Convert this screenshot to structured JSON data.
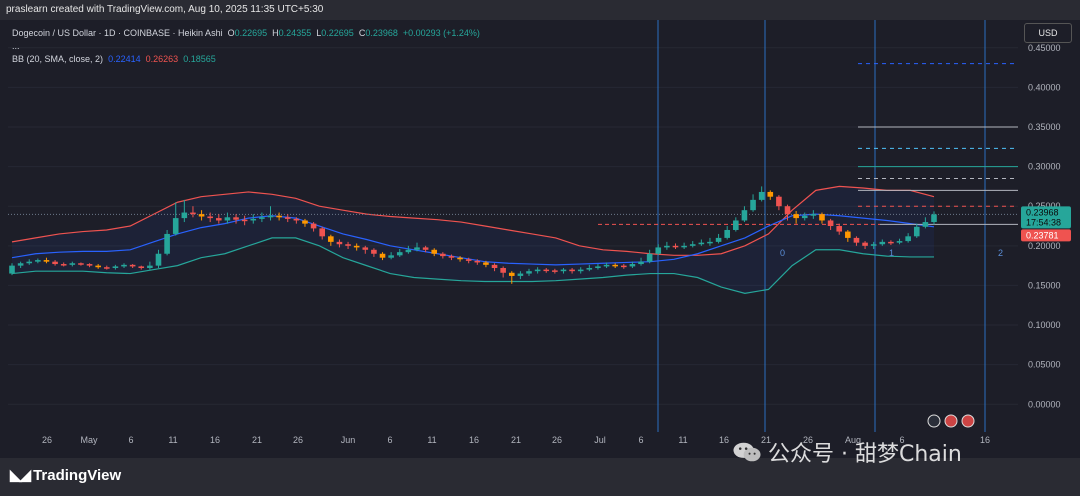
{
  "header": {
    "published": "praslearn created with TradingView.com, Aug 10, 2025 11:35 UTC+5:30"
  },
  "legend": {
    "symbol": "Dogecoin / US Dollar · 1D · COINBASE · Heikin Ashi",
    "o_label": "O",
    "o_value": "0.22695",
    "h_label": "H",
    "h_value": "0.24355",
    "l_label": "L",
    "l_value": "0.22695",
    "c_label": "C",
    "c_value": "0.23968",
    "change": "+0.00293 (+1.24%)",
    "ellipsis": "...",
    "bb_name": "BB (20, SMA, close, 2)",
    "bb_basis": "0.22414",
    "bb_upper": "0.26263",
    "bb_lower": "0.18565"
  },
  "currency_button": "USD",
  "price_tags": {
    "last_price": "0.23968",
    "countdown": "17:54:38",
    "basis_price": "0.23781"
  },
  "fib_labels": [
    "0",
    "1",
    "2"
  ],
  "footer": {
    "brand": "TradingView"
  },
  "watermark": {
    "text": "公众号 · 甜梦Chain"
  },
  "colors": {
    "up": "#26a69a",
    "down": "#ef5350",
    "orange": "#ff9800",
    "bb_upper": "#ef5350",
    "bb_basis": "#2962ff",
    "bb_lower": "#26a69a"
  },
  "chart_data": {
    "type": "candlestick",
    "y_axis_ticks": [
      "0.45000",
      "0.40000",
      "0.35000",
      "0.30000",
      "0.25000",
      "0.20000",
      "0.15000",
      "0.10000",
      "0.05000",
      "0.00000"
    ],
    "ylim": [
      -0.035,
      0.48
    ],
    "x_axis_ticks": [
      "26",
      "May",
      "6",
      "11",
      "16",
      "21",
      "26",
      "Jun",
      "6",
      "11",
      "16",
      "21",
      "26",
      "Jul",
      "6",
      "11",
      "16",
      "21",
      "26",
      "Aug",
      "6",
      "16"
    ],
    "dates_range": [
      "2025-04-21",
      "2025-08-10"
    ],
    "last_close": 0.23968,
    "horizontal_levels": [
      0.43,
      0.35,
      0.323,
      0.3,
      0.285,
      0.27,
      0.25,
      0.227
    ],
    "bb_upper": [
      0.205,
      0.21,
      0.215,
      0.218,
      0.22,
      0.225,
      0.24,
      0.255,
      0.262,
      0.265,
      0.268,
      0.265,
      0.26,
      0.25,
      0.245,
      0.24,
      0.237,
      0.235,
      0.233,
      0.23,
      0.225,
      0.22,
      0.215,
      0.21,
      0.2,
      0.195,
      0.193,
      0.19,
      0.188,
      0.188,
      0.19,
      0.2,
      0.215,
      0.245,
      0.27,
      0.275,
      0.273,
      0.27,
      0.27,
      0.262
    ],
    "bb_basis": [
      0.185,
      0.19,
      0.192,
      0.193,
      0.193,
      0.195,
      0.205,
      0.215,
      0.223,
      0.228,
      0.235,
      0.238,
      0.235,
      0.225,
      0.215,
      0.208,
      0.2,
      0.195,
      0.19,
      0.185,
      0.18,
      0.178,
      0.177,
      0.176,
      0.177,
      0.178,
      0.179,
      0.18,
      0.183,
      0.19,
      0.2,
      0.21,
      0.225,
      0.238,
      0.24,
      0.238,
      0.235,
      0.232,
      0.228,
      0.224
    ],
    "bb_lower": [
      0.165,
      0.168,
      0.168,
      0.168,
      0.166,
      0.165,
      0.17,
      0.175,
      0.185,
      0.19,
      0.2,
      0.21,
      0.21,
      0.2,
      0.185,
      0.175,
      0.165,
      0.16,
      0.158,
      0.156,
      0.155,
      0.155,
      0.155,
      0.156,
      0.158,
      0.16,
      0.163,
      0.165,
      0.165,
      0.16,
      0.148,
      0.14,
      0.145,
      0.175,
      0.195,
      0.195,
      0.19,
      0.187,
      0.186,
      0.186
    ],
    "candles": [
      {
        "o": 0.165,
        "c": 0.175,
        "h": 0.178,
        "l": 0.163
      },
      {
        "o": 0.175,
        "c": 0.178,
        "h": 0.18,
        "l": 0.172
      },
      {
        "o": 0.178,
        "c": 0.18,
        "h": 0.183,
        "l": 0.176
      },
      {
        "o": 0.18,
        "c": 0.182,
        "h": 0.184,
        "l": 0.178
      },
      {
        "o": 0.182,
        "c": 0.18,
        "h": 0.185,
        "l": 0.178
      },
      {
        "o": 0.18,
        "c": 0.177,
        "h": 0.182,
        "l": 0.175
      },
      {
        "o": 0.177,
        "c": 0.176,
        "h": 0.179,
        "l": 0.174
      },
      {
        "o": 0.176,
        "c": 0.178,
        "h": 0.18,
        "l": 0.174
      },
      {
        "o": 0.178,
        "c": 0.177,
        "h": 0.179,
        "l": 0.175
      },
      {
        "o": 0.177,
        "c": 0.175,
        "h": 0.178,
        "l": 0.173
      },
      {
        "o": 0.175,
        "c": 0.173,
        "h": 0.177,
        "l": 0.171
      },
      {
        "o": 0.173,
        "c": 0.172,
        "h": 0.175,
        "l": 0.17
      },
      {
        "o": 0.172,
        "c": 0.174,
        "h": 0.176,
        "l": 0.17
      },
      {
        "o": 0.174,
        "c": 0.176,
        "h": 0.178,
        "l": 0.172
      },
      {
        "o": 0.176,
        "c": 0.174,
        "h": 0.177,
        "l": 0.172
      },
      {
        "o": 0.174,
        "c": 0.172,
        "h": 0.175,
        "l": 0.17
      },
      {
        "o": 0.172,
        "c": 0.175,
        "h": 0.18,
        "l": 0.17
      },
      {
        "o": 0.175,
        "c": 0.19,
        "h": 0.195,
        "l": 0.172
      },
      {
        "o": 0.19,
        "c": 0.215,
        "h": 0.22,
        "l": 0.188
      },
      {
        "o": 0.215,
        "c": 0.235,
        "h": 0.255,
        "l": 0.213
      },
      {
        "o": 0.235,
        "c": 0.242,
        "h": 0.258,
        "l": 0.23
      },
      {
        "o": 0.242,
        "c": 0.24,
        "h": 0.25,
        "l": 0.236
      },
      {
        "o": 0.24,
        "c": 0.237,
        "h": 0.245,
        "l": 0.232
      },
      {
        "o": 0.237,
        "c": 0.235,
        "h": 0.242,
        "l": 0.23
      },
      {
        "o": 0.235,
        "c": 0.232,
        "h": 0.24,
        "l": 0.228
      },
      {
        "o": 0.232,
        "c": 0.236,
        "h": 0.242,
        "l": 0.228
      },
      {
        "o": 0.236,
        "c": 0.233,
        "h": 0.24,
        "l": 0.228
      },
      {
        "o": 0.233,
        "c": 0.232,
        "h": 0.238,
        "l": 0.226
      },
      {
        "o": 0.232,
        "c": 0.234,
        "h": 0.24,
        "l": 0.228
      },
      {
        "o": 0.234,
        "c": 0.236,
        "h": 0.242,
        "l": 0.23
      },
      {
        "o": 0.236,
        "c": 0.238,
        "h": 0.25,
        "l": 0.232
      },
      {
        "o": 0.238,
        "c": 0.236,
        "h": 0.242,
        "l": 0.232
      },
      {
        "o": 0.236,
        "c": 0.234,
        "h": 0.24,
        "l": 0.23
      },
      {
        "o": 0.234,
        "c": 0.232,
        "h": 0.236,
        "l": 0.228
      },
      {
        "o": 0.232,
        "c": 0.228,
        "h": 0.234,
        "l": 0.224
      },
      {
        "o": 0.228,
        "c": 0.222,
        "h": 0.23,
        "l": 0.218
      },
      {
        "o": 0.222,
        "c": 0.212,
        "h": 0.224,
        "l": 0.208
      },
      {
        "o": 0.212,
        "c": 0.205,
        "h": 0.214,
        "l": 0.2
      },
      {
        "o": 0.205,
        "c": 0.202,
        "h": 0.208,
        "l": 0.198
      },
      {
        "o": 0.202,
        "c": 0.2,
        "h": 0.205,
        "l": 0.196
      },
      {
        "o": 0.2,
        "c": 0.198,
        "h": 0.203,
        "l": 0.194
      },
      {
        "o": 0.198,
        "c": 0.195,
        "h": 0.2,
        "l": 0.19
      },
      {
        "o": 0.195,
        "c": 0.19,
        "h": 0.197,
        "l": 0.186
      },
      {
        "o": 0.19,
        "c": 0.185,
        "h": 0.192,
        "l": 0.182
      },
      {
        "o": 0.185,
        "c": 0.188,
        "h": 0.192,
        "l": 0.183
      },
      {
        "o": 0.188,
        "c": 0.192,
        "h": 0.196,
        "l": 0.186
      },
      {
        "o": 0.192,
        "c": 0.195,
        "h": 0.2,
        "l": 0.19
      },
      {
        "o": 0.195,
        "c": 0.198,
        "h": 0.204,
        "l": 0.193
      },
      {
        "o": 0.198,
        "c": 0.195,
        "h": 0.2,
        "l": 0.192
      },
      {
        "o": 0.195,
        "c": 0.19,
        "h": 0.197,
        "l": 0.187
      },
      {
        "o": 0.19,
        "c": 0.187,
        "h": 0.192,
        "l": 0.184
      },
      {
        "o": 0.187,
        "c": 0.185,
        "h": 0.189,
        "l": 0.182
      },
      {
        "o": 0.185,
        "c": 0.183,
        "h": 0.187,
        "l": 0.18
      },
      {
        "o": 0.183,
        "c": 0.181,
        "h": 0.185,
        "l": 0.178
      },
      {
        "o": 0.181,
        "c": 0.179,
        "h": 0.183,
        "l": 0.176
      },
      {
        "o": 0.179,
        "c": 0.176,
        "h": 0.181,
        "l": 0.173
      },
      {
        "o": 0.176,
        "c": 0.172,
        "h": 0.178,
        "l": 0.168
      },
      {
        "o": 0.172,
        "c": 0.166,
        "h": 0.174,
        "l": 0.16
      },
      {
        "o": 0.166,
        "c": 0.162,
        "h": 0.168,
        "l": 0.152
      },
      {
        "o": 0.162,
        "c": 0.165,
        "h": 0.168,
        "l": 0.158
      },
      {
        "o": 0.165,
        "c": 0.168,
        "h": 0.171,
        "l": 0.162
      },
      {
        "o": 0.168,
        "c": 0.17,
        "h": 0.173,
        "l": 0.165
      },
      {
        "o": 0.17,
        "c": 0.169,
        "h": 0.172,
        "l": 0.166
      },
      {
        "o": 0.169,
        "c": 0.168,
        "h": 0.171,
        "l": 0.165
      },
      {
        "o": 0.168,
        "c": 0.17,
        "h": 0.172,
        "l": 0.165
      },
      {
        "o": 0.17,
        "c": 0.168,
        "h": 0.172,
        "l": 0.165
      },
      {
        "o": 0.168,
        "c": 0.17,
        "h": 0.173,
        "l": 0.165
      },
      {
        "o": 0.17,
        "c": 0.172,
        "h": 0.176,
        "l": 0.168
      },
      {
        "o": 0.172,
        "c": 0.174,
        "h": 0.177,
        "l": 0.17
      },
      {
        "o": 0.174,
        "c": 0.176,
        "h": 0.179,
        "l": 0.172
      },
      {
        "o": 0.176,
        "c": 0.175,
        "h": 0.178,
        "l": 0.172
      },
      {
        "o": 0.175,
        "c": 0.174,
        "h": 0.177,
        "l": 0.171
      },
      {
        "o": 0.174,
        "c": 0.177,
        "h": 0.18,
        "l": 0.172
      },
      {
        "o": 0.177,
        "c": 0.18,
        "h": 0.185,
        "l": 0.175
      },
      {
        "o": 0.18,
        "c": 0.19,
        "h": 0.195,
        "l": 0.178
      },
      {
        "o": 0.19,
        "c": 0.198,
        "h": 0.202,
        "l": 0.188
      },
      {
        "o": 0.198,
        "c": 0.2,
        "h": 0.205,
        "l": 0.195
      },
      {
        "o": 0.2,
        "c": 0.199,
        "h": 0.203,
        "l": 0.196
      },
      {
        "o": 0.199,
        "c": 0.2,
        "h": 0.204,
        "l": 0.196
      },
      {
        "o": 0.2,
        "c": 0.202,
        "h": 0.206,
        "l": 0.198
      },
      {
        "o": 0.202,
        "c": 0.204,
        "h": 0.208,
        "l": 0.2
      },
      {
        "o": 0.204,
        "c": 0.205,
        "h": 0.21,
        "l": 0.2
      },
      {
        "o": 0.205,
        "c": 0.21,
        "h": 0.215,
        "l": 0.203
      },
      {
        "o": 0.21,
        "c": 0.22,
        "h": 0.225,
        "l": 0.208
      },
      {
        "o": 0.22,
        "c": 0.232,
        "h": 0.236,
        "l": 0.218
      },
      {
        "o": 0.232,
        "c": 0.245,
        "h": 0.25,
        "l": 0.23
      },
      {
        "o": 0.245,
        "c": 0.258,
        "h": 0.265,
        "l": 0.243
      },
      {
        "o": 0.258,
        "c": 0.268,
        "h": 0.275,
        "l": 0.256
      },
      {
        "o": 0.268,
        "c": 0.262,
        "h": 0.27,
        "l": 0.258
      },
      {
        "o": 0.262,
        "c": 0.25,
        "h": 0.264,
        "l": 0.245
      },
      {
        "o": 0.25,
        "c": 0.24,
        "h": 0.252,
        "l": 0.232
      },
      {
        "o": 0.24,
        "c": 0.235,
        "h": 0.244,
        "l": 0.228
      },
      {
        "o": 0.235,
        "c": 0.238,
        "h": 0.242,
        "l": 0.232
      },
      {
        "o": 0.238,
        "c": 0.24,
        "h": 0.245,
        "l": 0.234
      },
      {
        "o": 0.24,
        "c": 0.232,
        "h": 0.242,
        "l": 0.228
      },
      {
        "o": 0.232,
        "c": 0.225,
        "h": 0.234,
        "l": 0.22
      },
      {
        "o": 0.225,
        "c": 0.218,
        "h": 0.228,
        "l": 0.214
      },
      {
        "o": 0.218,
        "c": 0.21,
        "h": 0.22,
        "l": 0.205
      },
      {
        "o": 0.21,
        "c": 0.204,
        "h": 0.212,
        "l": 0.2
      },
      {
        "o": 0.204,
        "c": 0.2,
        "h": 0.206,
        "l": 0.196
      },
      {
        "o": 0.2,
        "c": 0.202,
        "h": 0.205,
        "l": 0.196
      },
      {
        "o": 0.202,
        "c": 0.205,
        "h": 0.208,
        "l": 0.2
      },
      {
        "o": 0.205,
        "c": 0.204,
        "h": 0.207,
        "l": 0.201
      },
      {
        "o": 0.204,
        "c": 0.206,
        "h": 0.209,
        "l": 0.202
      },
      {
        "o": 0.206,
        "c": 0.212,
        "h": 0.216,
        "l": 0.204
      },
      {
        "o": 0.212,
        "c": 0.224,
        "h": 0.228,
        "l": 0.21
      },
      {
        "o": 0.224,
        "c": 0.23,
        "h": 0.236,
        "l": 0.222
      },
      {
        "o": 0.23,
        "c": 0.23968,
        "h": 0.24355,
        "l": 0.22695
      }
    ]
  }
}
